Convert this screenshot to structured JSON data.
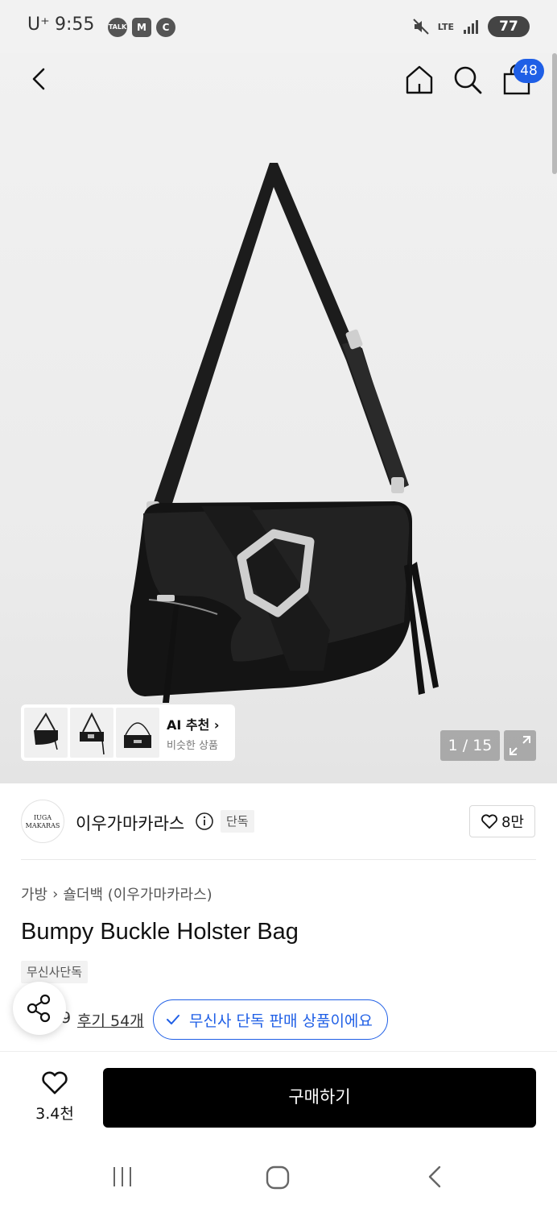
{
  "status_bar": {
    "carrier": "U⁺",
    "time": "9:55",
    "notification_icons": [
      "TALK",
      "M",
      "C"
    ],
    "network": "LTE",
    "battery": "77"
  },
  "header": {
    "cart_count": "48"
  },
  "gallery": {
    "ai_title": "AI 추천 ›",
    "ai_subtitle": "비슷한 상품",
    "counter": "1 / 15"
  },
  "brand": {
    "logo_line1": "IUGA",
    "logo_line2": "MAKARAS",
    "name": "이우가마카라스",
    "tag": "단독",
    "likes": "8만"
  },
  "product": {
    "breadcrumb_category": "가방",
    "breadcrumb_separator": "›",
    "breadcrumb_sub": "숄더백 (이우가마카라스)",
    "title": "Bumpy Buckle Holster Bag",
    "store_tag": "무신사단독",
    "rating_fragment": "9",
    "reviews": "후기 54개",
    "exclusive_notice": "무신사 단독 판매 상품이에요"
  },
  "action_bar": {
    "wish_count": "3.4천",
    "buy_label": "구매하기"
  },
  "colors": {
    "accent": "#1f5fe6",
    "buy_button": "#000000"
  },
  "icons": [
    "back-icon",
    "home-icon",
    "search-icon",
    "bag-icon",
    "expand-icon",
    "info-icon",
    "heart-icon",
    "share-icon",
    "check-icon",
    "recents-icon",
    "nav-home-icon",
    "nav-back-icon"
  ]
}
